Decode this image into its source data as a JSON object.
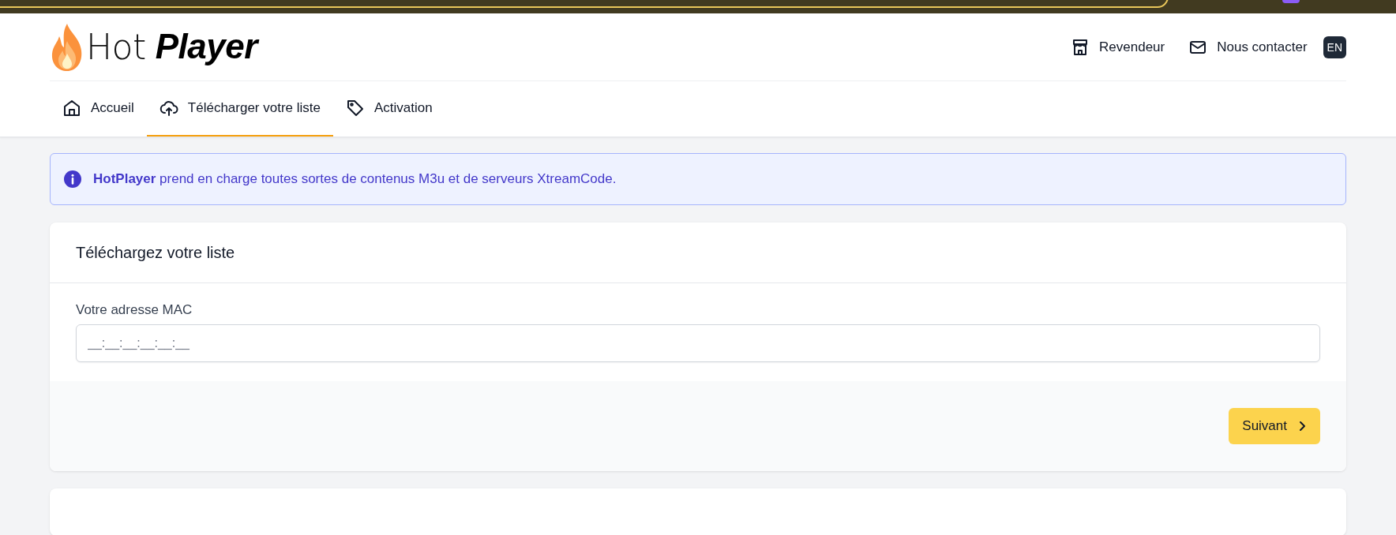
{
  "logo": {
    "light": "Hot",
    "bold": "Player"
  },
  "header_links": [
    {
      "label": "Revendeur",
      "kind": "store"
    },
    {
      "label": "Nous contacter",
      "kind": "mail"
    }
  ],
  "language": "EN",
  "tabs": [
    {
      "label": "Accueil",
      "kind": "home",
      "selected": false
    },
    {
      "label": "Télécharger votre liste",
      "kind": "upload",
      "selected": true
    },
    {
      "label": "Activation",
      "kind": "tag",
      "selected": false
    }
  ],
  "alert": {
    "text": "**HotPlayer** prend en charge toutes sortes de contenus M3u et de serveurs XtreamCode."
  },
  "card": {
    "title": "Téléchargez votre liste",
    "field": {
      "label": "Votre adresse MAC",
      "placeholder": "__:__:__:__:__:__"
    },
    "button": "Suivant"
  }
}
